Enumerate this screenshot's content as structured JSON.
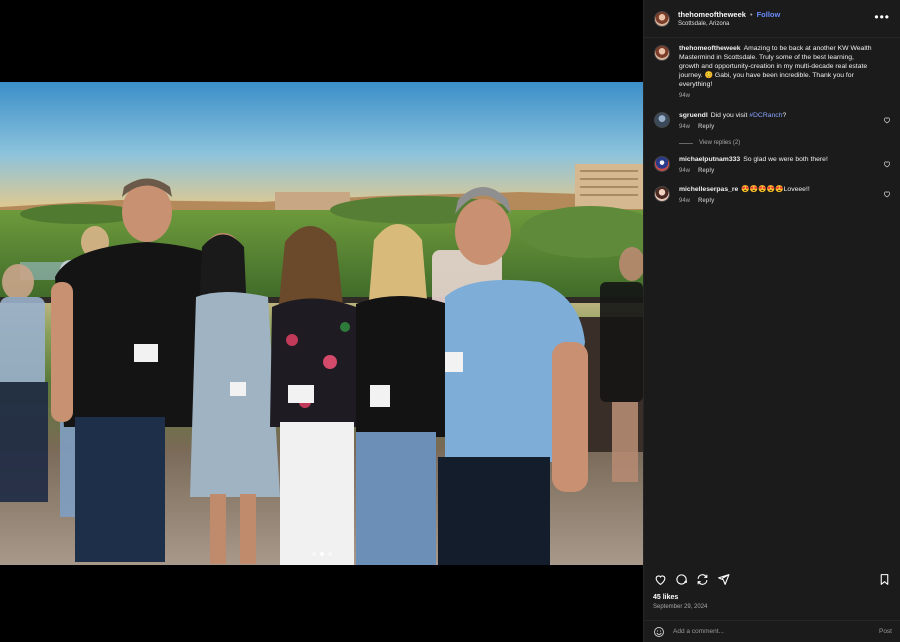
{
  "post": {
    "author": {
      "username": "thehomeoftheweek",
      "location": "Scottsdale, Arizona",
      "follow_label": "Follow"
    },
    "caption": {
      "username": "thehomeoftheweek",
      "text": "Amazing to be back at another KW Wealth Mastermind in Scottsdale. Truly some of the best learning, growth and opportunity-creation in my multi-decade real estate journey. 😊 Gabi, you have been incredible. Thank you for everything!",
      "age": "94w"
    },
    "comments": [
      {
        "username": "sgruendl",
        "text_before": "Did you visit ",
        "hashtag": "#DCRanch",
        "text_after": "?",
        "age": "94w",
        "reply_label": "Reply",
        "view_replies": "View replies (2)"
      },
      {
        "username": "michaelputnam333",
        "text": "So glad we were both there!",
        "age": "94w",
        "reply_label": "Reply"
      },
      {
        "username": "michelleserpas_re",
        "text": "😍😍😍😍😍Loveee!!",
        "age": "94w",
        "reply_label": "Reply"
      }
    ],
    "likes": "45 likes",
    "date": "September 29, 2024",
    "add_comment_placeholder": "Add a comment...",
    "post_label": "Post",
    "carousel": {
      "count": 3,
      "active_index": 1
    },
    "icons": {
      "more": "more-horizontal-icon",
      "like": "heart-icon",
      "comment": "comment-icon",
      "repost": "repost-icon",
      "share": "share-icon",
      "save": "bookmark-icon",
      "emoji": "emoji-icon"
    },
    "colors": {
      "panel_bg": "#1b1b1b",
      "link": "#6b8bff",
      "hashtag": "#8aa4ff",
      "muted": "#a8a8a8"
    }
  }
}
